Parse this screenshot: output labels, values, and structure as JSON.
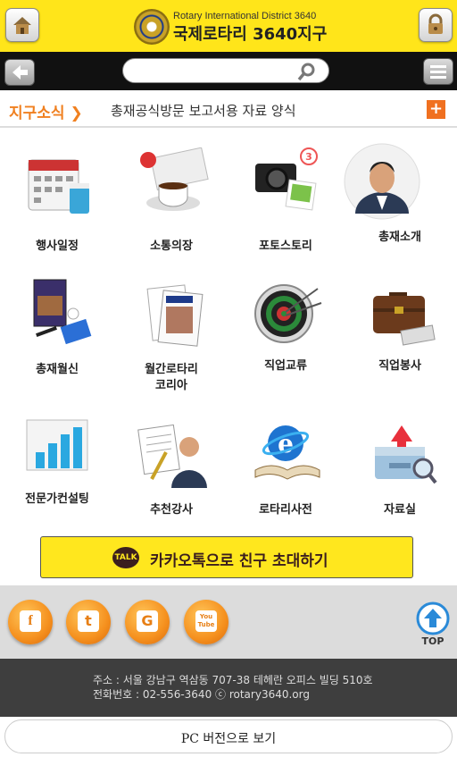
{
  "header": {
    "org_sub": "Rotary International District 3640",
    "org_name": "국제로타리 3640지구"
  },
  "search": {
    "placeholder": ""
  },
  "news": {
    "label": "지구소식",
    "headline": "총재공식방문 보고서용 자료 양식",
    "more": "+"
  },
  "menu": [
    {
      "label": "행사일정"
    },
    {
      "label": "소통의장"
    },
    {
      "label": "포토스토리",
      "badge": "3"
    },
    {
      "label": "총재소개"
    },
    {
      "label": "총재월신"
    },
    {
      "label": "월간로타리\n코리아"
    },
    {
      "label": "직업교류"
    },
    {
      "label": "직업봉사"
    },
    {
      "label": "전문가컨설팅"
    },
    {
      "label": "추천강사"
    },
    {
      "label": "로타리사전"
    },
    {
      "label": "자료실"
    }
  ],
  "kakao": {
    "badge": "TALK",
    "label": "카카오톡으로 친구 초대하기"
  },
  "social": {
    "facebook": "f",
    "twitter": "t",
    "google": "G",
    "youtube": "You Tube",
    "top": "TOP"
  },
  "footer": {
    "address": "주소 : 서울 강남구 역삼동 707-38 테헤란 오피스 빌딩 510호",
    "phone": "전화번호 : 02-556-3640   ⓒ rotary3640.org"
  },
  "pc_version": "PC 버전으로 보기",
  "colors": {
    "brand_yellow": "#FFE51A",
    "accent_orange": "#F08020",
    "nav_black": "#111111"
  }
}
